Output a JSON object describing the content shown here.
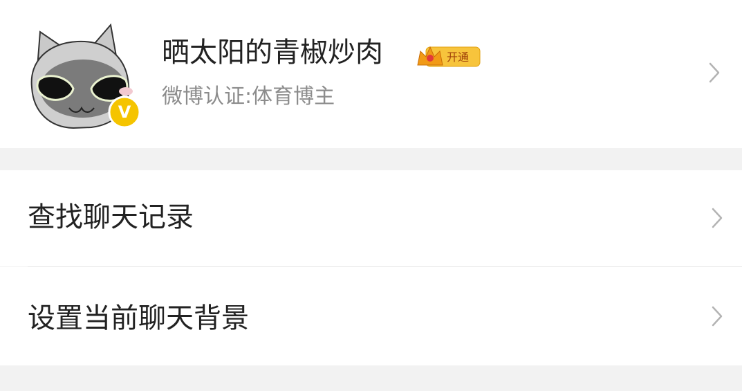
{
  "profile": {
    "name": "晒太阳的青椒炒肉",
    "vip_badge_label": "开通",
    "certification": "微博认证:体育博主",
    "verified_mark": "V",
    "icons": {
      "avatar": "cat-avatar-icon",
      "verified": "verified-v-icon",
      "crown": "crown-icon",
      "chevron": "chevron-right-icon"
    }
  },
  "menu": {
    "items": [
      {
        "label": "查找聊天记录"
      },
      {
        "label": "设置当前聊天背景"
      }
    ]
  },
  "colors": {
    "background": "#f2f2f2",
    "card": "#ffffff",
    "primary_text": "#222222",
    "secondary_text": "#8c8c8c",
    "chevron": "#b3b3b3",
    "vip_gold": "#f2b40c",
    "verified_yellow": "#f5c400"
  }
}
